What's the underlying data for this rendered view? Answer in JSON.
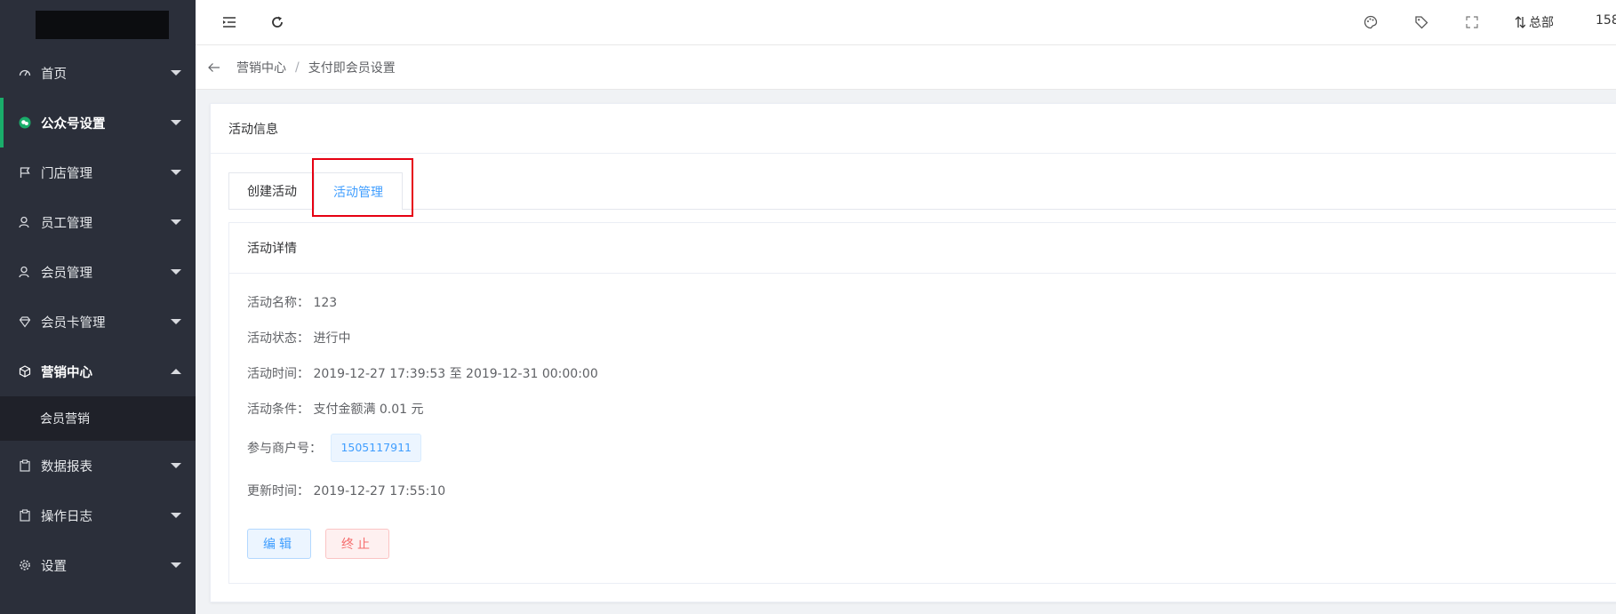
{
  "sidebar": {
    "items": [
      {
        "label": "首页",
        "icon": "dashboard-icon"
      },
      {
        "label": "公众号设置",
        "icon": "wechat-icon"
      },
      {
        "label": "门店管理",
        "icon": "flag-icon"
      },
      {
        "label": "员工管理",
        "icon": "user-icon"
      },
      {
        "label": "会员管理",
        "icon": "user-icon"
      },
      {
        "label": "会员卡管理",
        "icon": "diamond-icon"
      },
      {
        "label": "营销中心",
        "icon": "cube-icon"
      },
      {
        "label": "数据报表",
        "icon": "clipboard-icon"
      },
      {
        "label": "操作日志",
        "icon": "clipboard-icon"
      },
      {
        "label": "设置",
        "icon": "gear-icon"
      }
    ],
    "submenu": {
      "label": "会员营销"
    }
  },
  "header": {
    "branch_label": "总部",
    "user_label": "158"
  },
  "breadcrumb": {
    "parent": "营销中心",
    "separator": "/",
    "current": "支付即会员设置"
  },
  "card": {
    "title": "活动信息",
    "tabs": [
      {
        "label": "创建活动"
      },
      {
        "label": "活动管理"
      }
    ],
    "detail_title": "活动详情",
    "fields": {
      "name_label": "活动名称：",
      "name_value": "123",
      "status_label": "活动状态：",
      "status_value": "进行中",
      "time_label": "活动时间：",
      "time_value": "2019-12-27 17:39:53 至 2019-12-31 00:00:00",
      "condition_label": "活动条件：",
      "condition_value": "支付金额满 0.01 元",
      "merchant_label": "参与商户号：",
      "merchant_value": "1505117911",
      "updated_label": "更新时间：",
      "updated_value": "2019-12-27 17:55:10"
    },
    "buttons": {
      "edit": "编辑",
      "stop": "终止"
    }
  },
  "colors": {
    "sidebar_bg": "#2b2f3a",
    "accent_green": "#1aad6a",
    "primary_blue": "#409eff",
    "danger_red": "#f56c6c",
    "highlight_red": "#e60012"
  }
}
